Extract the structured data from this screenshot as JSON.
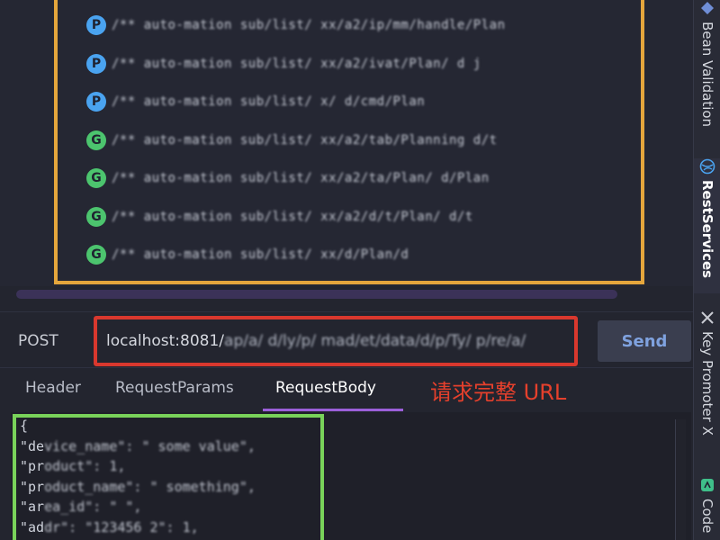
{
  "services": [
    {
      "method": "P",
      "kind": "p",
      "prefix": "/",
      "blurred": "/**  auto-mation  sub/list/  xx/a2/ip/mm/handle/Plan"
    },
    {
      "method": "P",
      "kind": "p",
      "prefix": "/",
      "blurred": "/**  auto-mation  sub/list/  xx/a2/ivat/Plan/  d  j"
    },
    {
      "method": "P",
      "kind": "p",
      "prefix": "/",
      "blurred": "/**  auto-mation  sub/list/  x/  d/cmd/Plan"
    },
    {
      "method": "G",
      "kind": "g",
      "prefix": "/",
      "blurred": "/**  auto-mation  sub/list/  xx/a2/tab/Planning  d/t"
    },
    {
      "method": "G",
      "kind": "g",
      "prefix": "/",
      "blurred": "/**  auto-mation  sub/list/  xx/a2/ta/Plan/  d/Plan"
    },
    {
      "method": "G",
      "kind": "g",
      "prefix": "/",
      "blurred": "/**  auto-mation  sub/list/  xx/a2/d/t/Plan/  d/t"
    },
    {
      "method": "G",
      "kind": "g",
      "prefix": "/",
      "blurred": "/**  auto-mation  sub/list/  xx/d/Plan/d"
    }
  ],
  "request": {
    "method": "POST",
    "url_visible": "localhost:8081/",
    "url_blurred": "ap/a/ d/ly/p/  mad/et/data/d/p/Ty/  p/re/a/",
    "send_label": "Send"
  },
  "tabs": {
    "header": "Header",
    "params": "RequestParams",
    "body": "RequestBody"
  },
  "annotation": "请求完整 URL",
  "body_lines": [
    {
      "plain": "{",
      "blurred": ""
    },
    {
      "plain": "  \"de",
      "blurred": "vice_name\": \"  some value\","
    },
    {
      "plain": "  \"pr",
      "blurred": "oduct\": 1,"
    },
    {
      "plain": "  \"pr",
      "blurred": "oduct_name\": \"  something\","
    },
    {
      "plain": "  \"ar",
      "blurred": "ea_id\": \"  \","
    },
    {
      "plain": "  \"ad",
      "blurred": "dr\": \"123456  2\": 1,"
    }
  ],
  "sidebar": {
    "bean_validation": "Bean Validation",
    "rest_services": "RestServices",
    "key_promoter": "Key Promoter X",
    "code": "Code"
  },
  "colors": {
    "list_highlight": "#e5a63c",
    "url_highlight": "#d9382e",
    "body_highlight": "#79d35a",
    "post_badge": "#4aa3f0",
    "get_badge": "#4cc46e",
    "tab_accent": "#9b5fd9"
  }
}
